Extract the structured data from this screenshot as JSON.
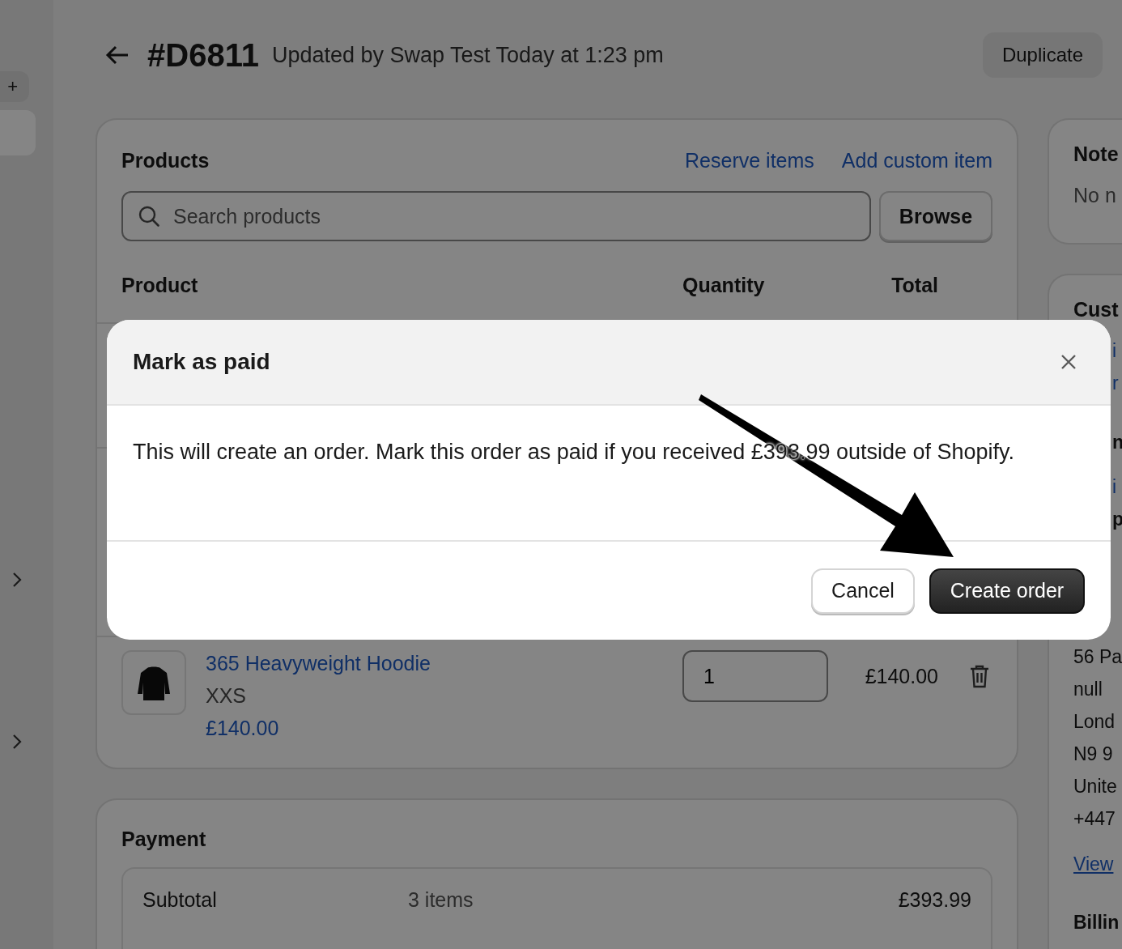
{
  "sidebar": {
    "badge": "+"
  },
  "header": {
    "order": "#D6811",
    "subtitle": "Updated by Swap Test Today at 1:23 pm",
    "buttons": [
      "Duplicate"
    ]
  },
  "products": {
    "title": "Products",
    "links": [
      "Reserve items",
      "Add custom item"
    ],
    "search": {
      "placeholder": "Search products"
    },
    "browse": "Browse",
    "columns": [
      "Product",
      "Quantity",
      "Total"
    ],
    "items": [
      {
        "name": "365 Heavyweight Hoodie",
        "variant": "XXS",
        "price": "£140.00",
        "quantity": "1",
        "total": "£140.00"
      }
    ]
  },
  "payment": {
    "title": "Payment",
    "rows": [
      {
        "label": "Subtotal",
        "detail": "3 items",
        "amount": "£393.99"
      }
    ]
  },
  "side": {
    "notes": {
      "title": "Note",
      "text": "No n"
    },
    "customer": {
      "title": "Cust",
      "lines": [
        {
          "text": "i",
          "kind": "peek-link"
        },
        {
          "text": "r",
          "kind": "peek-link"
        },
        {
          "text": "n",
          "kind": "peek-heading"
        },
        {
          "text": "i",
          "kind": "peek-link"
        },
        {
          "text": "p",
          "kind": "peek-heading"
        },
        {
          "text": "56 Pa",
          "kind": "text"
        },
        {
          "text": "null",
          "kind": "text"
        },
        {
          "text": "Lond",
          "kind": "text"
        },
        {
          "text": "N9 9",
          "kind": "text"
        },
        {
          "text": "Unite",
          "kind": "text"
        },
        {
          "text": "+447",
          "kind": "text"
        },
        {
          "text": "View",
          "kind": "link"
        },
        {
          "text": "Billin",
          "kind": "heading"
        }
      ]
    }
  },
  "modal": {
    "title": "Mark as paid",
    "message": "This will create an order. Mark this order as paid if you received £393.99 outside of Shopify.",
    "buttons": [
      {
        "label": "Cancel",
        "kind": "secondary"
      },
      {
        "label": "Create order",
        "kind": "primary"
      }
    ]
  }
}
